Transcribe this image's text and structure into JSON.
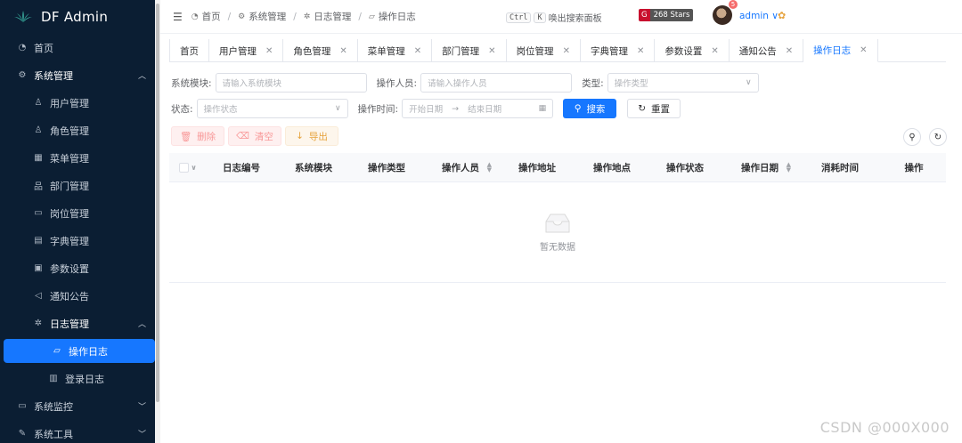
{
  "app": {
    "title": "DF Admin"
  },
  "sidebar": {
    "items": [
      {
        "label": "首页",
        "icon": "dashboard-icon",
        "level": 0
      },
      {
        "label": "系统管理",
        "icon": "gear-icon",
        "level": 0,
        "expanded": true
      },
      {
        "label": "用户管理",
        "icon": "user-icon",
        "level": 1
      },
      {
        "label": "角色管理",
        "icon": "users-icon",
        "level": 1
      },
      {
        "label": "菜单管理",
        "icon": "menu-icon",
        "level": 1
      },
      {
        "label": "部门管理",
        "icon": "org-icon",
        "level": 1
      },
      {
        "label": "岗位管理",
        "icon": "post-icon",
        "level": 1
      },
      {
        "label": "字典管理",
        "icon": "dict-icon",
        "level": 1
      },
      {
        "label": "参数设置",
        "icon": "params-icon",
        "level": 1
      },
      {
        "label": "通知公告",
        "icon": "notice-icon",
        "level": 1
      },
      {
        "label": "日志管理",
        "icon": "bug-icon",
        "level": 1,
        "expanded": true
      },
      {
        "label": "操作日志",
        "icon": "operlog-icon",
        "level": 2,
        "active": true
      },
      {
        "label": "登录日志",
        "icon": "loginlog-icon",
        "level": 2
      },
      {
        "label": "系统监控",
        "icon": "monitor-icon",
        "level": 0,
        "collapsed": true
      },
      {
        "label": "系统工具",
        "icon": "tool-icon",
        "level": 0,
        "collapsed": true
      }
    ]
  },
  "header": {
    "breadcrumb": [
      "首页",
      "系统管理",
      "日志管理",
      "操作日志"
    ],
    "shortcut_key1": "Ctrl",
    "shortcut_key2": "K",
    "search_panel_label": "唤出搜索面板",
    "stars": "268 Stars",
    "notification_count": "5",
    "user_name": "admin"
  },
  "tabs": [
    {
      "label": "首页",
      "closable": false
    },
    {
      "label": "用户管理",
      "closable": true
    },
    {
      "label": "角色管理",
      "closable": true
    },
    {
      "label": "菜单管理",
      "closable": true
    },
    {
      "label": "部门管理",
      "closable": true
    },
    {
      "label": "岗位管理",
      "closable": true
    },
    {
      "label": "字典管理",
      "closable": true
    },
    {
      "label": "参数设置",
      "closable": true
    },
    {
      "label": "通知公告",
      "closable": true
    },
    {
      "label": "操作日志",
      "closable": true,
      "active": true
    }
  ],
  "filters": {
    "module_label": "系统模块:",
    "module_placeholder": "请输入系统模块",
    "operator_label": "操作人员:",
    "operator_placeholder": "请输入操作人员",
    "type_label": "类型:",
    "type_placeholder": "操作类型",
    "status_label": "状态:",
    "status_placeholder": "操作状态",
    "time_label": "操作时间:",
    "start_placeholder": "开始日期",
    "end_placeholder": "结束日期",
    "search_button": "搜索",
    "reset_button": "重置"
  },
  "toolbar": {
    "delete_button": "删除",
    "clear_button": "清空",
    "export_button": "导出"
  },
  "table": {
    "columns": [
      "日志编号",
      "系统模块",
      "操作类型",
      "操作人员",
      "操作地址",
      "操作地点",
      "操作状态",
      "操作日期",
      "消耗时间",
      "操作"
    ],
    "empty_text": "暂无数据"
  },
  "watermark": "CSDN @000X000",
  "colors": {
    "primary": "#1677ff",
    "sidebar_bg": "#0b1e33"
  }
}
